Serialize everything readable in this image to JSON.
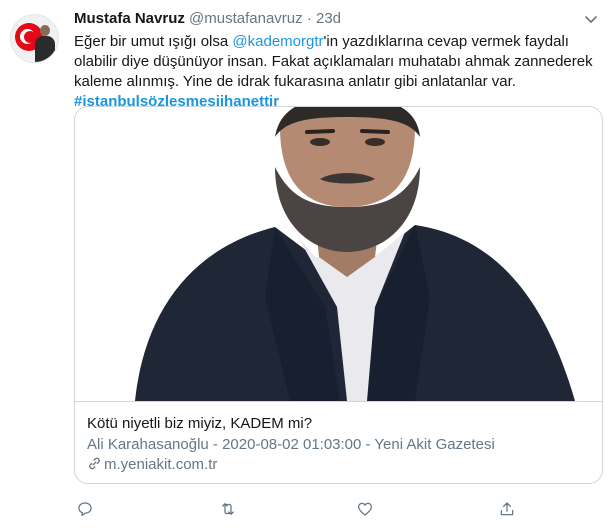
{
  "tweet": {
    "author_name": "Mustafa Navruz",
    "handle": "@mustafanavruz",
    "separator": "·",
    "time": "23d",
    "text_parts": [
      "Eğer bir umut ışığı olsa ",
      "@kademorgtr",
      "'in yazdıklarına cevap vermek faydalı olabilir diye düşünüyor insan. Fakat açıklamaları muhatabı ahmak zannederek kaleme alınmış. Yine de idrak fukarasına anlatır gibi anlatanlar var. ",
      "#istanbulsözleşmesiihanettir"
    ]
  },
  "card": {
    "title": "Kötü niyetli biz miyiz, KADEM mi?",
    "description": "Ali Karahasanoğlu - 2020-08-02 01:03:00 - Yeni Akit Gazetesi",
    "domain": "m.yeniakit.com.tr",
    "image_subject": "portrait-photo"
  },
  "actions": {
    "icons": [
      "reply-icon",
      "retweet-icon",
      "like-icon",
      "share-icon"
    ]
  },
  "colors": {
    "link": "#1b95e0",
    "secondary_text": "#657786",
    "border": "#ccd6dd"
  }
}
